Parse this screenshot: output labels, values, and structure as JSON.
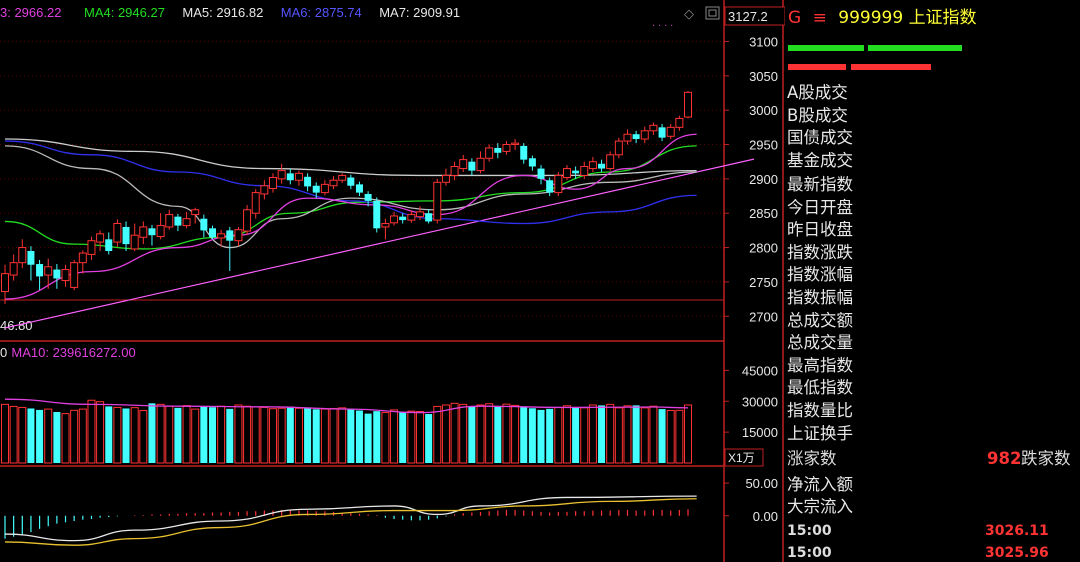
{
  "chart_data": [
    {
      "type": "candlestick",
      "legend": [
        {
          "text": "3: 2966.22",
          "color": "#e040e0"
        },
        {
          "text": "MA4: 2946.27",
          "color": "#22dd22"
        },
        {
          "text": "MA5: 2916.82",
          "color": "#e8e8e8"
        },
        {
          "text": "MA6: 2875.74",
          "color": "#5555ff"
        },
        {
          "text": "MA7: 2909.91",
          "color": "#e8e8e8"
        }
      ],
      "y_top_label": "3127.2",
      "y_ticks": [
        3100,
        3050,
        3000,
        2950,
        2900,
        2850,
        2800,
        2750,
        2700
      ],
      "ylim": [
        2680,
        3140
      ],
      "low_label": "46.80",
      "candles": [
        {
          "o": 2736,
          "c": 2762,
          "h": 2775,
          "l": 2718
        },
        {
          "o": 2760,
          "c": 2778,
          "h": 2790,
          "l": 2752
        },
        {
          "o": 2778,
          "c": 2800,
          "h": 2812,
          "l": 2770
        },
        {
          "o": 2795,
          "c": 2775,
          "h": 2802,
          "l": 2752
        },
        {
          "o": 2776,
          "c": 2758,
          "h": 2782,
          "l": 2738
        },
        {
          "o": 2760,
          "c": 2772,
          "h": 2784,
          "l": 2740
        },
        {
          "o": 2768,
          "c": 2755,
          "h": 2776,
          "l": 2740
        },
        {
          "o": 2752,
          "c": 2768,
          "h": 2775,
          "l": 2743
        },
        {
          "o": 2742,
          "c": 2778,
          "h": 2782,
          "l": 2738
        },
        {
          "o": 2778,
          "c": 2792,
          "h": 2796,
          "l": 2762
        },
        {
          "o": 2790,
          "c": 2810,
          "h": 2816,
          "l": 2782
        },
        {
          "o": 2808,
          "c": 2820,
          "h": 2825,
          "l": 2795
        },
        {
          "o": 2812,
          "c": 2795,
          "h": 2822,
          "l": 2790
        },
        {
          "o": 2808,
          "c": 2835,
          "h": 2841,
          "l": 2801
        },
        {
          "o": 2830,
          "c": 2805,
          "h": 2838,
          "l": 2795
        },
        {
          "o": 2798,
          "c": 2818,
          "h": 2835,
          "l": 2795
        },
        {
          "o": 2815,
          "c": 2830,
          "h": 2838,
          "l": 2805
        },
        {
          "o": 2828,
          "c": 2818,
          "h": 2833,
          "l": 2803
        },
        {
          "o": 2816,
          "c": 2832,
          "h": 2850,
          "l": 2812
        },
        {
          "o": 2830,
          "c": 2848,
          "h": 2855,
          "l": 2826
        },
        {
          "o": 2845,
          "c": 2832,
          "h": 2849,
          "l": 2824
        },
        {
          "o": 2832,
          "c": 2842,
          "h": 2852,
          "l": 2828
        },
        {
          "o": 2848,
          "c": 2855,
          "h": 2858,
          "l": 2835
        },
        {
          "o": 2842,
          "c": 2825,
          "h": 2848,
          "l": 2815
        },
        {
          "o": 2828,
          "c": 2815,
          "h": 2832,
          "l": 2812
        },
        {
          "o": 2814,
          "c": 2820,
          "h": 2826,
          "l": 2802
        },
        {
          "o": 2825,
          "c": 2810,
          "h": 2830,
          "l": 2766
        },
        {
          "o": 2810,
          "c": 2826,
          "h": 2830,
          "l": 2802
        },
        {
          "o": 2824,
          "c": 2855,
          "h": 2862,
          "l": 2818
        },
        {
          "o": 2850,
          "c": 2880,
          "h": 2885,
          "l": 2842
        },
        {
          "o": 2878,
          "c": 2890,
          "h": 2898,
          "l": 2870
        },
        {
          "o": 2886,
          "c": 2902,
          "h": 2908,
          "l": 2880
        },
        {
          "o": 2900,
          "c": 2912,
          "h": 2922,
          "l": 2893
        },
        {
          "o": 2908,
          "c": 2898,
          "h": 2915,
          "l": 2892
        },
        {
          "o": 2898,
          "c": 2908,
          "h": 2912,
          "l": 2890
        },
        {
          "o": 2903,
          "c": 2889,
          "h": 2908,
          "l": 2882
        },
        {
          "o": 2890,
          "c": 2880,
          "h": 2895,
          "l": 2872
        },
        {
          "o": 2880,
          "c": 2892,
          "h": 2898,
          "l": 2876
        },
        {
          "o": 2890,
          "c": 2898,
          "h": 2904,
          "l": 2885
        },
        {
          "o": 2898,
          "c": 2905,
          "h": 2908,
          "l": 2894
        },
        {
          "o": 2902,
          "c": 2890,
          "h": 2906,
          "l": 2885
        },
        {
          "o": 2892,
          "c": 2880,
          "h": 2896,
          "l": 2875
        },
        {
          "o": 2878,
          "c": 2868,
          "h": 2882,
          "l": 2860
        },
        {
          "o": 2868,
          "c": 2828,
          "h": 2873,
          "l": 2822
        },
        {
          "o": 2830,
          "c": 2835,
          "h": 2842,
          "l": 2812
        },
        {
          "o": 2836,
          "c": 2846,
          "h": 2852,
          "l": 2832
        },
        {
          "o": 2845,
          "c": 2840,
          "h": 2850,
          "l": 2835
        },
        {
          "o": 2840,
          "c": 2848,
          "h": 2854,
          "l": 2836
        },
        {
          "o": 2845,
          "c": 2852,
          "h": 2860,
          "l": 2840
        },
        {
          "o": 2850,
          "c": 2838,
          "h": 2856,
          "l": 2835
        },
        {
          "o": 2840,
          "c": 2895,
          "h": 2900,
          "l": 2835
        },
        {
          "o": 2895,
          "c": 2905,
          "h": 2915,
          "l": 2890
        },
        {
          "o": 2905,
          "c": 2918,
          "h": 2925,
          "l": 2898
        },
        {
          "o": 2915,
          "c": 2928,
          "h": 2935,
          "l": 2910
        },
        {
          "o": 2925,
          "c": 2912,
          "h": 2930,
          "l": 2905
        },
        {
          "o": 2912,
          "c": 2930,
          "h": 2940,
          "l": 2908
        },
        {
          "o": 2930,
          "c": 2945,
          "h": 2950,
          "l": 2925
        },
        {
          "o": 2945,
          "c": 2938,
          "h": 2952,
          "l": 2930
        },
        {
          "o": 2940,
          "c": 2950,
          "h": 2955,
          "l": 2935
        },
        {
          "o": 2950,
          "c": 2952,
          "h": 2958,
          "l": 2942
        },
        {
          "o": 2948,
          "c": 2928,
          "h": 2952,
          "l": 2922
        },
        {
          "o": 2930,
          "c": 2918,
          "h": 2934,
          "l": 2912
        },
        {
          "o": 2915,
          "c": 2900,
          "h": 2920,
          "l": 2892
        },
        {
          "o": 2898,
          "c": 2880,
          "h": 2902,
          "l": 2875
        },
        {
          "o": 2880,
          "c": 2905,
          "h": 2910,
          "l": 2875
        },
        {
          "o": 2902,
          "c": 2915,
          "h": 2920,
          "l": 2898
        },
        {
          "o": 2912,
          "c": 2908,
          "h": 2918,
          "l": 2900
        },
        {
          "o": 2905,
          "c": 2918,
          "h": 2925,
          "l": 2900
        },
        {
          "o": 2915,
          "c": 2925,
          "h": 2932,
          "l": 2910
        },
        {
          "o": 2922,
          "c": 2915,
          "h": 2928,
          "l": 2910
        },
        {
          "o": 2915,
          "c": 2935,
          "h": 2940,
          "l": 2912
        },
        {
          "o": 2935,
          "c": 2955,
          "h": 2960,
          "l": 2930
        },
        {
          "o": 2955,
          "c": 2965,
          "h": 2972,
          "l": 2950
        },
        {
          "o": 2965,
          "c": 2958,
          "h": 2970,
          "l": 2952
        },
        {
          "o": 2958,
          "c": 2970,
          "h": 2976,
          "l": 2952
        },
        {
          "o": 2970,
          "c": 2978,
          "h": 2982,
          "l": 2964
        },
        {
          "o": 2975,
          "c": 2960,
          "h": 2980,
          "l": 2955
        },
        {
          "o": 2962,
          "c": 2975,
          "h": 2980,
          "l": 2958
        },
        {
          "o": 2975,
          "c": 2988,
          "h": 2992,
          "l": 2970
        },
        {
          "o": 2990,
          "c": 3026,
          "h": 3028,
          "l": 2988
        }
      ],
      "ma_series": [
        {
          "name": "MA4",
          "color": "#22dd22",
          "values": [
            [
              0,
              2838
            ],
            [
              8,
              2805
            ],
            [
              16,
              2798
            ],
            [
              25,
              2815
            ],
            [
              33,
              2850
            ],
            [
              41,
              2866
            ],
            [
              50,
              2868
            ],
            [
              60,
              2880
            ],
            [
              70,
              2910
            ],
            [
              80,
              2948
            ]
          ]
        },
        {
          "name": "MA6",
          "color": "#3030ee",
          "values": [
            [
              0,
              2955
            ],
            [
              10,
              2935
            ],
            [
              20,
              2910
            ],
            [
              30,
              2890
            ],
            [
              40,
              2868
            ],
            [
              50,
              2842
            ],
            [
              60,
              2835
            ],
            [
              70,
              2852
            ],
            [
              80,
              2876
            ]
          ]
        },
        {
          "name": "MA5",
          "color": "#bbbbbb",
          "values": [
            [
              0,
              2948
            ],
            [
              10,
              2915
            ],
            [
              20,
              2860
            ],
            [
              26,
              2800
            ],
            [
              32,
              2842
            ],
            [
              40,
              2872
            ],
            [
              50,
              2855
            ],
            [
              60,
              2878
            ],
            [
              70,
              2895
            ],
            [
              80,
              2910
            ]
          ]
        },
        {
          "name": "MA7",
          "color": "#cccccc",
          "values": [
            [
              0,
              2958
            ],
            [
              15,
              2940
            ],
            [
              30,
              2915
            ],
            [
              48,
              2905
            ],
            [
              65,
              2905
            ],
            [
              80,
              2912
            ]
          ]
        },
        {
          "name": "MA3",
          "color": "#e040e0",
          "values": [
            [
              0,
              2725
            ],
            [
              10,
              2765
            ],
            [
              20,
              2800
            ],
            [
              27,
              2818
            ],
            [
              35,
              2872
            ],
            [
              43,
              2862
            ],
            [
              50,
              2848
            ],
            [
              60,
              2905
            ],
            [
              66,
              2885
            ],
            [
              72,
              2915
            ],
            [
              80,
              2965
            ]
          ]
        }
      ],
      "trendline": {
        "from": [
          0,
          2683
        ],
        "to": [
          82,
          2920
        ],
        "color": "#ff60ff"
      }
    },
    {
      "type": "bar",
      "legend": [
        {
          "text": "0",
          "color": "#e8e8e8"
        },
        {
          "text": "MA10: 239616272.00",
          "color": "#e040e0"
        }
      ],
      "y_ticks": [
        45000,
        30000,
        15000
      ],
      "ylim": [
        0,
        52000
      ],
      "unit_label": "X1万",
      "values": [
        28500,
        27500,
        27000,
        26500,
        25800,
        26200,
        24800,
        24000,
        25600,
        26200,
        30500,
        29800,
        27500,
        27000,
        26500,
        26900,
        25500,
        29000,
        28500,
        27600,
        26800,
        27900,
        26200,
        27500,
        27100,
        27600,
        26300,
        28200,
        27600,
        27200,
        27000,
        26400,
        26600,
        27400,
        26600,
        26800,
        26100,
        26200,
        26500,
        26800,
        26000,
        25500,
        24000,
        25200,
        24500,
        25800,
        24900,
        25200,
        25000,
        23800,
        27500,
        28200,
        29000,
        28500,
        27600,
        28200,
        28800,
        27400,
        28600,
        28000,
        27200,
        26600,
        25800,
        26300,
        27000,
        27800,
        27100,
        26800,
        28200,
        28000,
        28500,
        26800,
        27800,
        28000,
        26800,
        27600,
        26200,
        25500,
        25600,
        28200
      ],
      "up": [
        1,
        1,
        1,
        0,
        0,
        1,
        0,
        1,
        1,
        1,
        1,
        1,
        0,
        1,
        0,
        1,
        1,
        0,
        1,
        1,
        0,
        1,
        1,
        0,
        0,
        1,
        0,
        1,
        1,
        1,
        1,
        1,
        1,
        0,
        1,
        0,
        0,
        1,
        1,
        1,
        0,
        0,
        0,
        0,
        1,
        1,
        0,
        1,
        1,
        0,
        1,
        1,
        1,
        1,
        0,
        1,
        1,
        0,
        1,
        1,
        0,
        0,
        0,
        0,
        1,
        1,
        0,
        1,
        1,
        0,
        1,
        1,
        1,
        0,
        1,
        1,
        0,
        1,
        1,
        1
      ],
      "ma_series": [
        {
          "name": "MA10",
          "color": "#e040e0",
          "values": [
            [
              0,
              31000
            ],
            [
              10,
              28500
            ],
            [
              20,
              27600
            ],
            [
              30,
              27300
            ],
            [
              40,
              26200
            ],
            [
              48,
              24500
            ],
            [
              55,
              27600
            ],
            [
              65,
              27000
            ],
            [
              75,
              27200
            ],
            [
              79,
              26800
            ]
          ]
        }
      ]
    },
    {
      "type": "macd",
      "y_ticks": [
        50.0,
        0.0
      ],
      "ylim": [
        -60,
        70
      ],
      "hist": [
        -35,
        -32,
        -28,
        -25,
        -20,
        -16,
        -12,
        -10,
        -8,
        -6,
        -5,
        -3,
        -2,
        -1,
        0,
        1,
        1,
        2,
        2,
        3,
        3,
        4,
        4,
        4,
        5,
        5,
        6,
        6,
        7,
        7,
        8,
        8,
        9,
        9,
        8,
        8,
        7,
        7,
        6,
        5,
        4,
        3,
        2,
        1,
        -3,
        -5,
        -6,
        -7,
        -7,
        -6,
        -4,
        -1,
        2,
        4,
        5,
        6,
        7,
        8,
        9,
        9,
        8,
        7,
        6,
        5,
        6,
        6,
        7,
        7,
        8,
        8,
        8,
        9,
        9,
        8,
        8,
        9,
        9,
        8,
        9,
        10
      ],
      "lines": [
        {
          "name": "DIF",
          "color": "#e8e8e8",
          "values": [
            [
              0,
              -28
            ],
            [
              8,
              -38
            ],
            [
              15,
              -22
            ],
            [
              25,
              -8
            ],
            [
              35,
              10
            ],
            [
              45,
              15
            ],
            [
              50,
              2
            ],
            [
              55,
              15
            ],
            [
              65,
              28
            ],
            [
              80,
              30
            ]
          ]
        },
        {
          "name": "DEA",
          "color": "#e8c030",
          "values": [
            [
              0,
              -40
            ],
            [
              8,
              -45
            ],
            [
              15,
              -35
            ],
            [
              25,
              -18
            ],
            [
              35,
              2
            ],
            [
              45,
              8
            ],
            [
              52,
              8
            ],
            [
              60,
              15
            ],
            [
              70,
              22
            ],
            [
              80,
              26
            ]
          ]
        }
      ]
    }
  ],
  "panel": {
    "title_prefix": "G",
    "title_menu": "≡",
    "title_code": "999999",
    "title_name": "上证指数",
    "labels": [
      "A股成交",
      "B股成交",
      "国债成交",
      "基金成交",
      "最新指数",
      "今日开盘",
      "昨日收盘",
      "指数涨跌",
      "指数涨幅",
      "指数振幅",
      "总成交额",
      "总成交量",
      "最高指数",
      "最低指数",
      "指数量比",
      "上证换手"
    ],
    "breadth": {
      "up_label": "涨家数",
      "up_value": "",
      "down_value": "982",
      "down_label": "跌家数"
    },
    "flow_labels": [
      "净流入额",
      "大宗流入"
    ],
    "ticks": [
      {
        "time": "15:00",
        "value": "3026.11"
      },
      {
        "time": "15:00",
        "value": "3025.96"
      }
    ],
    "colors": {
      "red": "#ff3333",
      "green": "#22dd22",
      "yellow": "#ffff33"
    }
  }
}
